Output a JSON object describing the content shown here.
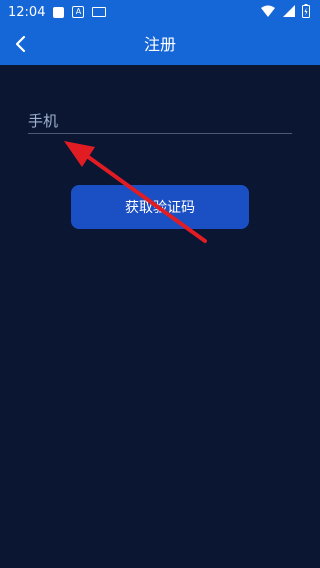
{
  "status_bar": {
    "time": "12:04",
    "icons": [
      "square-icon",
      "a-icon",
      "keyboard-icon",
      "wifi-icon",
      "signal-icon",
      "battery-icon"
    ]
  },
  "header": {
    "title": "注册",
    "back_icon": "chevron-left-icon"
  },
  "form": {
    "phone_placeholder": "手机",
    "phone_value": "",
    "get_code_label": "获取验证码"
  },
  "colors": {
    "header": "#1566d6",
    "background": "#0b1633",
    "button": "#1b4fc4",
    "arrow": "#e11d23"
  }
}
